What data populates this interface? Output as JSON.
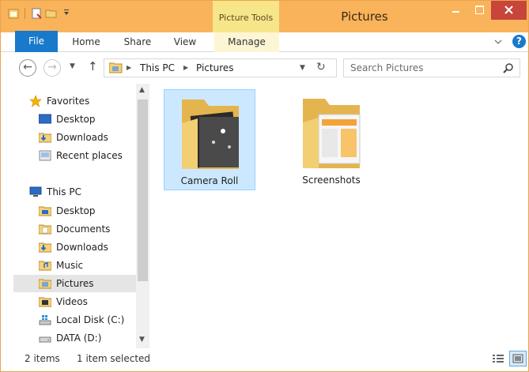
{
  "window": {
    "title": "Pictures",
    "context_tab_group": "Picture Tools",
    "close_color": "#c7453b",
    "frame_color": "#f9b35b"
  },
  "ribbon": {
    "tabs": [
      {
        "label": "File"
      },
      {
        "label": "Home"
      },
      {
        "label": "Share"
      },
      {
        "label": "View"
      },
      {
        "label": "Manage"
      }
    ],
    "help": "?"
  },
  "address": {
    "crumbs": [
      "This PC",
      "Pictures"
    ],
    "search_placeholder": "Search Pictures"
  },
  "nav": {
    "favorites": {
      "label": "Favorites",
      "items": [
        "Desktop",
        "Downloads",
        "Recent places"
      ]
    },
    "this_pc": {
      "label": "This PC",
      "items": [
        "Desktop",
        "Documents",
        "Downloads",
        "Music",
        "Pictures",
        "Videos",
        "Local Disk (C:)",
        "DATA (D:)"
      ]
    },
    "selected": "Pictures"
  },
  "content": {
    "items": [
      {
        "name": "Camera Roll",
        "selected": true
      },
      {
        "name": "Screenshots",
        "selected": false
      }
    ]
  },
  "status": {
    "item_count": "2 items",
    "selection": "1 item selected"
  }
}
